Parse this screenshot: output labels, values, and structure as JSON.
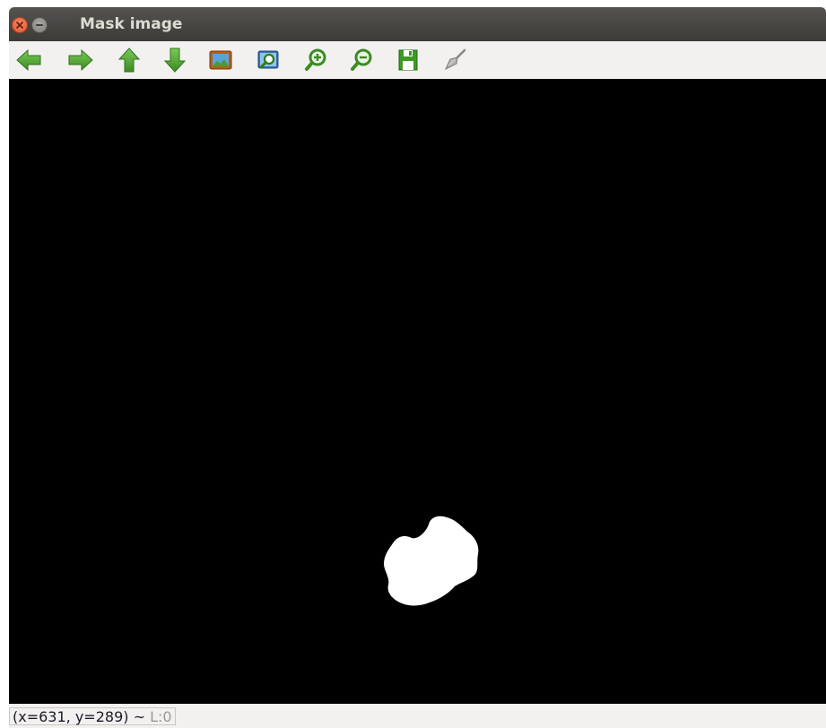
{
  "window": {
    "title": "Mask image"
  },
  "toolbar": {
    "items": [
      {
        "name": "pan-left-icon"
      },
      {
        "name": "pan-right-icon"
      },
      {
        "name": "pan-up-icon"
      },
      {
        "name": "pan-down-icon"
      },
      {
        "name": "original-size-icon"
      },
      {
        "name": "zoom-fit-icon"
      },
      {
        "name": "zoom-in-icon"
      },
      {
        "name": "zoom-out-icon"
      },
      {
        "name": "save-icon"
      },
      {
        "name": "properties-brush-icon"
      }
    ]
  },
  "status": {
    "coordinates": "(x=631, y=289)",
    "separator": "~",
    "level": "L:0"
  },
  "colors": {
    "titlebar": "#3c3b37",
    "toolbar_icon_green": "#4aa02c",
    "canvas_background": "#000000",
    "mask_blob": "#ffffff"
  }
}
